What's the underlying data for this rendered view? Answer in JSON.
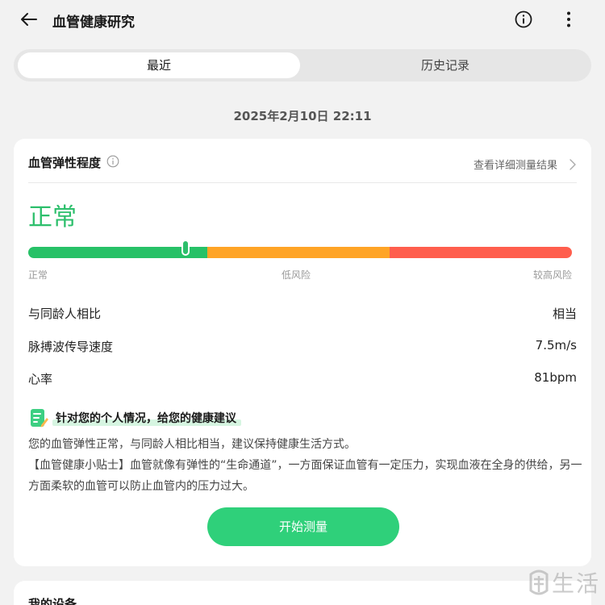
{
  "header": {
    "title": "血管健康研究",
    "back_icon": "arrow-left-icon",
    "info_icon": "info-circle-icon",
    "more_icon": "more-vertical-icon"
  },
  "tabs": [
    {
      "label": "最近",
      "active": true
    },
    {
      "label": "历史记录",
      "active": false
    }
  ],
  "date": "2025年2月10日 22:11",
  "card": {
    "title": "血管弹性程度",
    "detail_link": "查看详细测量结果",
    "status": "正常",
    "status_color": "#2dbf6c",
    "scale": {
      "level": 0.29,
      "labels": [
        "正常",
        "低风险",
        "较高风险"
      ],
      "colors": [
        "#27c167",
        "#ffa426",
        "#ff5e4d"
      ]
    },
    "rows": [
      {
        "label": "与同龄人相比",
        "value": "相当"
      },
      {
        "label": "脉搏波传导速度",
        "value": "7.5m/s"
      },
      {
        "label": "心率",
        "value": "81bpm"
      }
    ],
    "advice_title": "针对您的个人情况，给您的健康建议",
    "advice_p1": "您的血管弹性正常，与同龄人相比相当，建议保持健康生活方式。",
    "advice_p2": "【血管健康小贴士】血管就像有弹性的“生命通道”，一方面保证血管有一定压力，实现血液在全身的供给，另一方面柔软的血管可以防止血管内的压力过大。",
    "start_button": "开始测量",
    "accent_color": "#2fd07a"
  },
  "devices": {
    "title": "我的设备"
  },
  "watermark": {
    "text": "生活"
  }
}
